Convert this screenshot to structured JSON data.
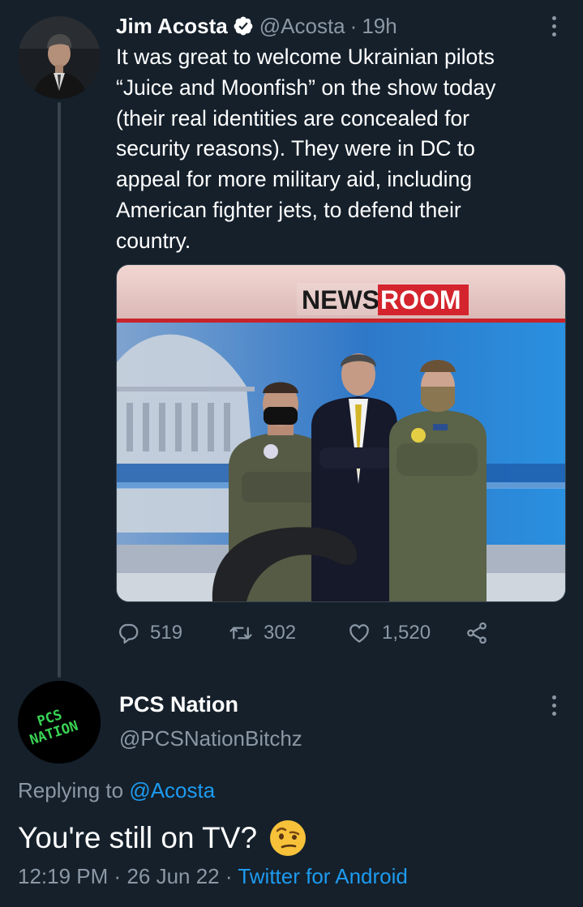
{
  "tweet": {
    "author_name": "Jim Acosta",
    "verified_icon": "verified-badge-icon",
    "handle": "@Acosta",
    "separator": "·",
    "time": "19h",
    "more_icon": "more-vertical-icon",
    "text": "It was great to welcome Ukrainian pilots\n“Juice and Moonfish” on the show today\n(their real identities are concealed for\nsecurity reasons). They were in DC to\nappeal for more military aid, including\nAmerican fighter jets, to defend their\ncountry.",
    "media": {
      "sign_left": "NEWS",
      "sign_right": "ROOM"
    },
    "actions": {
      "reply_count": "519",
      "retweet_count": "302",
      "like_count": "1,520",
      "reply_icon": "reply-icon",
      "retweet_icon": "retweet-icon",
      "like_icon": "heart-icon",
      "share_icon": "share-icon"
    }
  },
  "reply": {
    "avatar_text_line1": "PCS",
    "avatar_text_line2": "NATION",
    "author_name": "PCS Nation",
    "handle": "@PCSNationBitchz",
    "replying_prefix": "Replying to",
    "replying_to": "@Acosta",
    "text": "You're still on TV?",
    "emoji": "face-with-raised-eyebrow-emoji",
    "time": "12:19 PM",
    "separator": "·",
    "date": "26 Jun 22",
    "source": "Twitter for Android"
  },
  "colors": {
    "background": "#15202b",
    "text": "#ffffff",
    "secondary": "#8b98a5",
    "link": "#1d9bf0",
    "thread_line": "#38444d",
    "avatar_green": "#39d353",
    "emoji_yellow": "#f7c23a"
  }
}
